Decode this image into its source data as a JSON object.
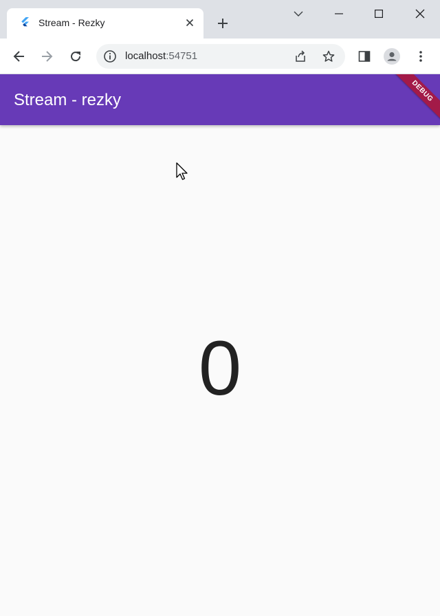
{
  "browser": {
    "tab": {
      "title": "Stream - Rezky",
      "favicon": "flutter-icon",
      "close_icon": "close-icon"
    },
    "new_tab_icon": "plus-icon",
    "window_controls": [
      "chevron-down-icon",
      "minimize-icon",
      "maximize-icon",
      "close-icon"
    ],
    "toolbar": {
      "back_icon": "arrow-left-icon",
      "forward_icon": "arrow-right-icon",
      "reload_icon": "reload-icon",
      "url_host": "localhost",
      "url_port": ":54751",
      "share_icon": "share-icon",
      "bookmark_icon": "star-icon",
      "side_panel_icon": "side-panel-icon",
      "profile_icon": "avatar-icon",
      "menu_icon": "kebab-menu-icon"
    }
  },
  "app": {
    "appbar_title": "Stream - rezky",
    "debug_banner": "DEBUG",
    "counter_value": "0"
  },
  "colors": {
    "primary": "#673ab7",
    "debug_banner": "#a31a48",
    "background": "#fafafa",
    "tabstrip": "#dee1e6"
  }
}
